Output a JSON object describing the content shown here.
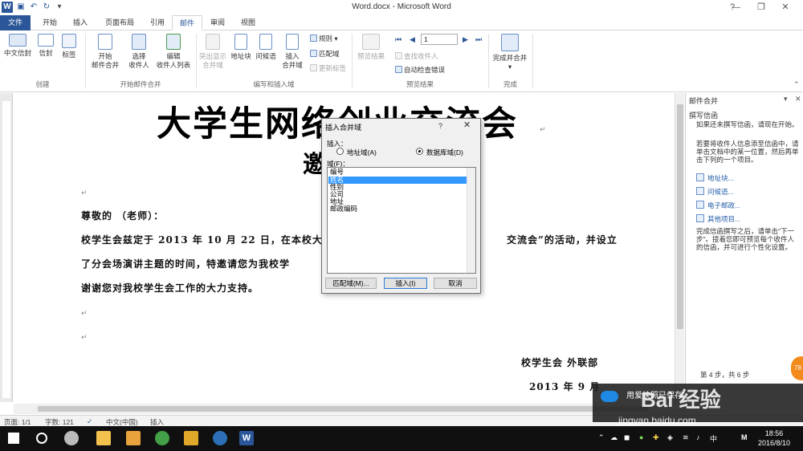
{
  "window": {
    "title": "Word.docx - Microsoft Word",
    "min": "—",
    "restore": "❐",
    "close": "✕",
    "help": "?"
  },
  "tabs": [
    "文件",
    "开始",
    "插入",
    "页面布局",
    "引用",
    "邮件",
    "审阅",
    "视图"
  ],
  "ribbon": {
    "create": {
      "label": "创建",
      "chinese_envelope": "中文信封",
      "envelope": "信封",
      "labels": "标签"
    },
    "start_merge": {
      "label": "开始邮件合并",
      "start": [
        "开始",
        "邮件合并"
      ],
      "select": [
        "选择",
        "收件人"
      ],
      "edit": [
        "编辑",
        "收件人列表"
      ]
    },
    "write_insert": {
      "label": "编写和插入域",
      "highlight": [
        "突出显示",
        "合并域"
      ],
      "address_block": "地址块",
      "greeting": "问候语",
      "insert_field": [
        "插入",
        "合并域"
      ],
      "rules": "规则",
      "match_fields": "匹配域",
      "update_labels": "更新标签"
    },
    "preview": {
      "label": "预览结果",
      "preview_results": "预览结果",
      "record": "1",
      "find_recipient": "查找收件人",
      "auto_check": "自动检查错误"
    },
    "finish": {
      "label": "完成",
      "finish_merge": "完成并合并"
    }
  },
  "document": {
    "title_line1": "大学生网络创业交流会",
    "title_line2": "邀",
    "salutation": "尊敬的          （老师）：",
    "body_line1": "校学生会兹定于 2013 年 10 月 22 日，在本校大",
    "body_line1_tail": "交流会”的活动，并设立",
    "body_line2": "了分会场演讲主题的时间，特邀请您为我校学",
    "body_line3": "谢谢您对我校学生会工作的大力支持。",
    "signature": "校学生会  外联部",
    "date": "2013 年 9 月"
  },
  "pane": {
    "title": "邮件合并",
    "heading": "撰写信函",
    "intro": "如果还未撰写信函，请现在开始。",
    "instruction": "若要将收件人信息添至信函中，请单击文档中的某一位置，然后再单击下列的一个项目。",
    "links": [
      "地址块...",
      "问候语...",
      "电子邮政...",
      "其他项目..."
    ],
    "after": "完成信函撰写之后，请单击\"下一步\"。接着您即可预览每个收件人的信函，并可进行个性化设置。",
    "step": "第 4 步，共 6 步"
  },
  "dialog": {
    "title": "插入合并域",
    "insert_label": "插入：",
    "radio_address": "地址域(A)",
    "radio_database": "数据库域(D)",
    "fields_label": "域(F)：",
    "fields": [
      "编号",
      "姓名",
      "性别",
      "公司",
      "地址",
      "邮政编码"
    ],
    "selected_index": 1,
    "btn_match": "匹配域(M)...",
    "btn_insert": "插入(I)",
    "btn_cancel": "取消"
  },
  "status": {
    "page": "页面: 1/1",
    "words": "字数: 121",
    "language": "中文(中国)",
    "mode": "插入"
  },
  "taskbar": {
    "time": "18:56",
    "date": "2016/8/10",
    "ime": "中",
    "ime2": "M"
  },
  "watermark": {
    "toast": "用爱快照已保存",
    "logo": "Bai 经验",
    "url": "jingyan.baidu.com",
    "badge": "78"
  },
  "colors": {
    "accent": "#2b579a",
    "selection": "#3399ff",
    "taskbar": "#101010"
  }
}
